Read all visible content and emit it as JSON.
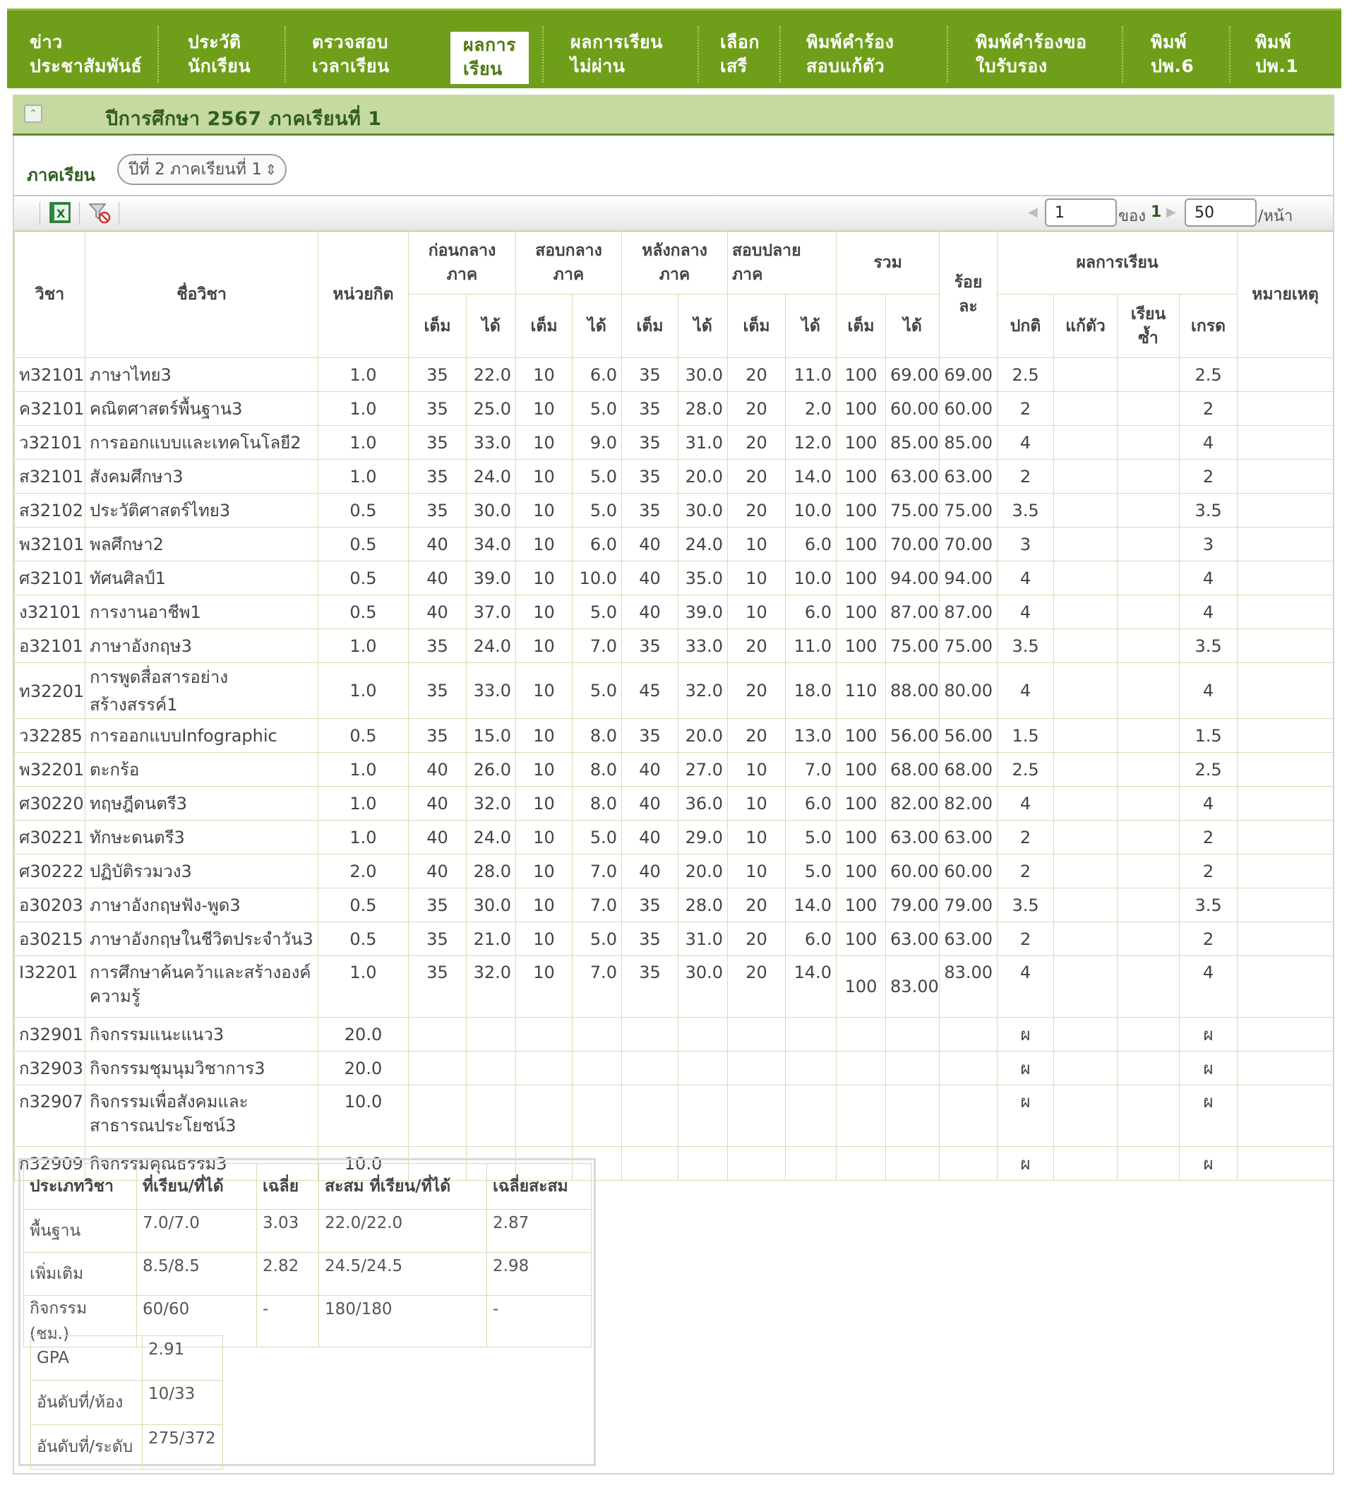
{
  "nav": {
    "items": [
      {
        "label": "ข่าว\nประชาสัมพันธ์"
      },
      {
        "label": "ประวัติ\nนักเรียน"
      },
      {
        "label": "ตรวจสอบ\nเวลาเรียน"
      },
      {
        "label": "ผลการ\nเรียน"
      },
      {
        "label": "ผลการเรียน\nไม่ผ่าน"
      },
      {
        "label": "เลือก\nเสรี"
      },
      {
        "label": "พิมพ์คำร้อง\nสอบแก้ตัว"
      },
      {
        "label": "พิมพ์คำร้องขอ\nใบรับรอง"
      },
      {
        "label": "พิมพ์\nปพ.6"
      },
      {
        "label": "พิมพ์\nปพ.1"
      }
    ]
  },
  "section": {
    "title": "ปีการศึกษา 2567 ภาคเรียนที่ 1"
  },
  "term": {
    "label": "ภาคเรียน",
    "selected": "ปีที่ 2 ภาคเรียนที่ 1"
  },
  "pager": {
    "page": "1",
    "of_label": "ของ",
    "total_pages": "1",
    "page_size": "50",
    "per_page_label": "/หน้า"
  },
  "table": {
    "headers": {
      "code": "วิชา",
      "name": "ชื่อวิชา",
      "credit": "หน่วยกิต",
      "pre_mid": "ก่อนกลาง\nภาค",
      "mid": "สอบกลาง\nภาค",
      "post_mid": "หลังกลาง\nภาค",
      "final": "สอบปลาย\nภาค",
      "total": "รวม",
      "percent": "ร้อย\nละ",
      "result": "ผลการเรียน",
      "note": "หมายเหตุ",
      "full": "เต็ม",
      "got": "ได้",
      "normal": "ปกติ",
      "remedial": "แก้ตัว",
      "repeat": "เรียน\nซ้ำ",
      "grade": "เกรด"
    },
    "rows": [
      {
        "code": "ท32101",
        "name": "ภาษาไทย3",
        "credit": "1.0",
        "pm_f": "35",
        "pm_g": "22.0",
        "m_f": "10",
        "m_g": "6.0",
        "po_f": "35",
        "po_g": "30.0",
        "f_f": "20",
        "f_g": "11.0",
        "t_f": "100",
        "t_g": "69.00",
        "pct": "69.00",
        "normal": "2.5",
        "remedial": "",
        "repeat": "",
        "grade": "2.5",
        "note": ""
      },
      {
        "code": "ค32101",
        "name": "คณิตศาสตร์พื้นฐาน3",
        "credit": "1.0",
        "pm_f": "35",
        "pm_g": "25.0",
        "m_f": "10",
        "m_g": "5.0",
        "po_f": "35",
        "po_g": "28.0",
        "f_f": "20",
        "f_g": "2.0",
        "t_f": "100",
        "t_g": "60.00",
        "pct": "60.00",
        "normal": "2",
        "remedial": "",
        "repeat": "",
        "grade": "2",
        "note": ""
      },
      {
        "code": "ว32101",
        "name": "การออกแบบและเทคโนโลยี2",
        "credit": "1.0",
        "pm_f": "35",
        "pm_g": "33.0",
        "m_f": "10",
        "m_g": "9.0",
        "po_f": "35",
        "po_g": "31.0",
        "f_f": "20",
        "f_g": "12.0",
        "t_f": "100",
        "t_g": "85.00",
        "pct": "85.00",
        "normal": "4",
        "remedial": "",
        "repeat": "",
        "grade": "4",
        "note": ""
      },
      {
        "code": "ส32101",
        "name": "สังคมศึกษา3",
        "credit": "1.0",
        "pm_f": "35",
        "pm_g": "24.0",
        "m_f": "10",
        "m_g": "5.0",
        "po_f": "35",
        "po_g": "20.0",
        "f_f": "20",
        "f_g": "14.0",
        "t_f": "100",
        "t_g": "63.00",
        "pct": "63.00",
        "normal": "2",
        "remedial": "",
        "repeat": "",
        "grade": "2",
        "note": ""
      },
      {
        "code": "ส32102",
        "name": "ประวัติศาสตร์ไทย3",
        "credit": "0.5",
        "pm_f": "35",
        "pm_g": "30.0",
        "m_f": "10",
        "m_g": "5.0",
        "po_f": "35",
        "po_g": "30.0",
        "f_f": "20",
        "f_g": "10.0",
        "t_f": "100",
        "t_g": "75.00",
        "pct": "75.00",
        "normal": "3.5",
        "remedial": "",
        "repeat": "",
        "grade": "3.5",
        "note": ""
      },
      {
        "code": "พ32101",
        "name": "พลศึกษา2",
        "credit": "0.5",
        "pm_f": "40",
        "pm_g": "34.0",
        "m_f": "10",
        "m_g": "6.0",
        "po_f": "40",
        "po_g": "24.0",
        "f_f": "10",
        "f_g": "6.0",
        "t_f": "100",
        "t_g": "70.00",
        "pct": "70.00",
        "normal": "3",
        "remedial": "",
        "repeat": "",
        "grade": "3",
        "note": ""
      },
      {
        "code": "ศ32101",
        "name": "ทัศนศิลป์1",
        "credit": "0.5",
        "pm_f": "40",
        "pm_g": "39.0",
        "m_f": "10",
        "m_g": "10.0",
        "po_f": "40",
        "po_g": "35.0",
        "f_f": "10",
        "f_g": "10.0",
        "t_f": "100",
        "t_g": "94.00",
        "pct": "94.00",
        "normal": "4",
        "remedial": "",
        "repeat": "",
        "grade": "4",
        "note": ""
      },
      {
        "code": "ง32101",
        "name": "การงานอาชีพ1",
        "credit": "0.5",
        "pm_f": "40",
        "pm_g": "37.0",
        "m_f": "10",
        "m_g": "5.0",
        "po_f": "40",
        "po_g": "39.0",
        "f_f": "10",
        "f_g": "6.0",
        "t_f": "100",
        "t_g": "87.00",
        "pct": "87.00",
        "normal": "4",
        "remedial": "",
        "repeat": "",
        "grade": "4",
        "note": ""
      },
      {
        "code": "อ32101",
        "name": "ภาษาอังกฤษ3",
        "credit": "1.0",
        "pm_f": "35",
        "pm_g": "24.0",
        "m_f": "10",
        "m_g": "7.0",
        "po_f": "35",
        "po_g": "33.0",
        "f_f": "20",
        "f_g": "11.0",
        "t_f": "100",
        "t_g": "75.00",
        "pct": "75.00",
        "normal": "3.5",
        "remedial": "",
        "repeat": "",
        "grade": "3.5",
        "note": ""
      },
      {
        "code": "ท32201",
        "name": "การพูดสื่อสารอย่างสร้างสรรค์1",
        "credit": "1.0",
        "pm_f": "35",
        "pm_g": "33.0",
        "m_f": "10",
        "m_g": "5.0",
        "po_f": "45",
        "po_g": "32.0",
        "f_f": "20",
        "f_g": "18.0",
        "t_f": "110",
        "t_g": "88.00",
        "pct": "80.00",
        "normal": "4",
        "remedial": "",
        "repeat": "",
        "grade": "4",
        "note": ""
      },
      {
        "code": "ว32285",
        "name": "การออกแบบInfographic",
        "credit": "0.5",
        "pm_f": "35",
        "pm_g": "15.0",
        "m_f": "10",
        "m_g": "8.0",
        "po_f": "35",
        "po_g": "20.0",
        "f_f": "20",
        "f_g": "13.0",
        "t_f": "100",
        "t_g": "56.00",
        "pct": "56.00",
        "normal": "1.5",
        "remedial": "",
        "repeat": "",
        "grade": "1.5",
        "note": ""
      },
      {
        "code": "พ32201",
        "name": "ตะกร้อ",
        "credit": "1.0",
        "pm_f": "40",
        "pm_g": "26.0",
        "m_f": "10",
        "m_g": "8.0",
        "po_f": "40",
        "po_g": "27.0",
        "f_f": "10",
        "f_g": "7.0",
        "t_f": "100",
        "t_g": "68.00",
        "pct": "68.00",
        "normal": "2.5",
        "remedial": "",
        "repeat": "",
        "grade": "2.5",
        "note": ""
      },
      {
        "code": "ศ30220",
        "name": "ทฤษฎีดนตรี3",
        "credit": "1.0",
        "pm_f": "40",
        "pm_g": "32.0",
        "m_f": "10",
        "m_g": "8.0",
        "po_f": "40",
        "po_g": "36.0",
        "f_f": "10",
        "f_g": "6.0",
        "t_f": "100",
        "t_g": "82.00",
        "pct": "82.00",
        "normal": "4",
        "remedial": "",
        "repeat": "",
        "grade": "4",
        "note": ""
      },
      {
        "code": "ศ30221",
        "name": "ทักษะดนตรี3",
        "credit": "1.0",
        "pm_f": "40",
        "pm_g": "24.0",
        "m_f": "10",
        "m_g": "5.0",
        "po_f": "40",
        "po_g": "29.0",
        "f_f": "10",
        "f_g": "5.0",
        "t_f": "100",
        "t_g": "63.00",
        "pct": "63.00",
        "normal": "2",
        "remedial": "",
        "repeat": "",
        "grade": "2",
        "note": ""
      },
      {
        "code": "ศ30222",
        "name": "ปฏิบัติรวมวง3",
        "credit": "2.0",
        "pm_f": "40",
        "pm_g": "28.0",
        "m_f": "10",
        "m_g": "7.0",
        "po_f": "40",
        "po_g": "20.0",
        "f_f": "10",
        "f_g": "5.0",
        "t_f": "100",
        "t_g": "60.00",
        "pct": "60.00",
        "normal": "2",
        "remedial": "",
        "repeat": "",
        "grade": "2",
        "note": ""
      },
      {
        "code": "อ30203",
        "name": "ภาษาอังกฤษฟัง-พูด3",
        "credit": "0.5",
        "pm_f": "35",
        "pm_g": "30.0",
        "m_f": "10",
        "m_g": "7.0",
        "po_f": "35",
        "po_g": "28.0",
        "f_f": "20",
        "f_g": "14.0",
        "t_f": "100",
        "t_g": "79.00",
        "pct": "79.00",
        "normal": "3.5",
        "remedial": "",
        "repeat": "",
        "grade": "3.5",
        "note": ""
      },
      {
        "code": "อ30215",
        "name": "ภาษาอังกฤษในชีวิตประจำวัน3",
        "credit": "0.5",
        "pm_f": "35",
        "pm_g": "21.0",
        "m_f": "10",
        "m_g": "5.0",
        "po_f": "35",
        "po_g": "31.0",
        "f_f": "20",
        "f_g": "6.0",
        "t_f": "100",
        "t_g": "63.00",
        "pct": "63.00",
        "normal": "2",
        "remedial": "",
        "repeat": "",
        "grade": "2",
        "note": ""
      },
      {
        "code": "I32201",
        "name": "การศึกษาค้นคว้าและสร้างองค์ความรู้",
        "credit": "1.0",
        "pm_f": "35",
        "pm_g": "32.0",
        "m_f": "10",
        "m_g": "7.0",
        "po_f": "35",
        "po_g": "30.0",
        "f_f": "20",
        "f_g": "14.0",
        "t_f": "100",
        "t_g": "83.00",
        "pct": "83.00",
        "normal": "4",
        "remedial": "",
        "repeat": "",
        "grade": "4",
        "note": "",
        "tall": true
      },
      {
        "code": "ก32901",
        "name": "กิจกรรมแนะแนว3",
        "credit": "20.0",
        "pm_f": "",
        "pm_g": "",
        "m_f": "",
        "m_g": "",
        "po_f": "",
        "po_g": "",
        "f_f": "",
        "f_g": "",
        "t_f": "",
        "t_g": "",
        "pct": "",
        "normal": "ผ",
        "remedial": "",
        "repeat": "",
        "grade": "ผ",
        "note": ""
      },
      {
        "code": "ก32903",
        "name": "กิจกรรมชุมนุมวิชาการ3",
        "credit": "20.0",
        "pm_f": "",
        "pm_g": "",
        "m_f": "",
        "m_g": "",
        "po_f": "",
        "po_g": "",
        "f_f": "",
        "f_g": "",
        "t_f": "",
        "t_g": "",
        "pct": "",
        "normal": "ผ",
        "remedial": "",
        "repeat": "",
        "grade": "ผ",
        "note": ""
      },
      {
        "code": "ก32907",
        "name": "กิจกรรมเพื่อสังคมและสาธารณประโยชน์3",
        "credit": "10.0",
        "pm_f": "",
        "pm_g": "",
        "m_f": "",
        "m_g": "",
        "po_f": "",
        "po_g": "",
        "f_f": "",
        "f_g": "",
        "t_f": "",
        "t_g": "",
        "pct": "",
        "normal": "ผ",
        "remedial": "",
        "repeat": "",
        "grade": "ผ",
        "note": "",
        "tall": true
      },
      {
        "code": "ก32909",
        "name": "กิจกรรมคุณธรรม3",
        "credit": "10.0",
        "pm_f": "",
        "pm_g": "",
        "m_f": "",
        "m_g": "",
        "po_f": "",
        "po_g": "",
        "f_f": "",
        "f_g": "",
        "t_f": "",
        "t_g": "",
        "pct": "",
        "normal": "ผ",
        "remedial": "",
        "repeat": "",
        "grade": "ผ",
        "note": ""
      }
    ]
  },
  "summary": {
    "headers": [
      "ประเภทวิชา",
      "ที่เรียน/ที่ได้",
      "เฉลี่ย",
      "สะสม ที่เรียน/ที่ได้",
      "เฉลี่ยสะสม"
    ],
    "rows": [
      {
        "type": "พื้นฐาน",
        "studied": "7.0/7.0",
        "avg": "3.03",
        "cum_studied": "22.0/22.0",
        "cum_avg": "2.87"
      },
      {
        "type": "เพิ่มเติม",
        "studied": "8.5/8.5",
        "avg": "2.82",
        "cum_studied": "24.5/24.5",
        "cum_avg": "2.98"
      },
      {
        "type": "กิจกรรม (ชม.)",
        "studied": "60/60",
        "avg": "-",
        "cum_studied": "180/180",
        "cum_avg": "-"
      }
    ],
    "gpa_label": "GPA",
    "gpa": "2.91",
    "rank_class_label": "อันดับที่/ห้อง",
    "rank_class": "10/33",
    "rank_level_label": "อันดับที่/ระดับ",
    "rank_level": "275/372"
  },
  "colors": {
    "nav_bg": "#6f9f1a",
    "section_bg": "#c5d9a0",
    "grid_line": "#cfe0b4"
  }
}
